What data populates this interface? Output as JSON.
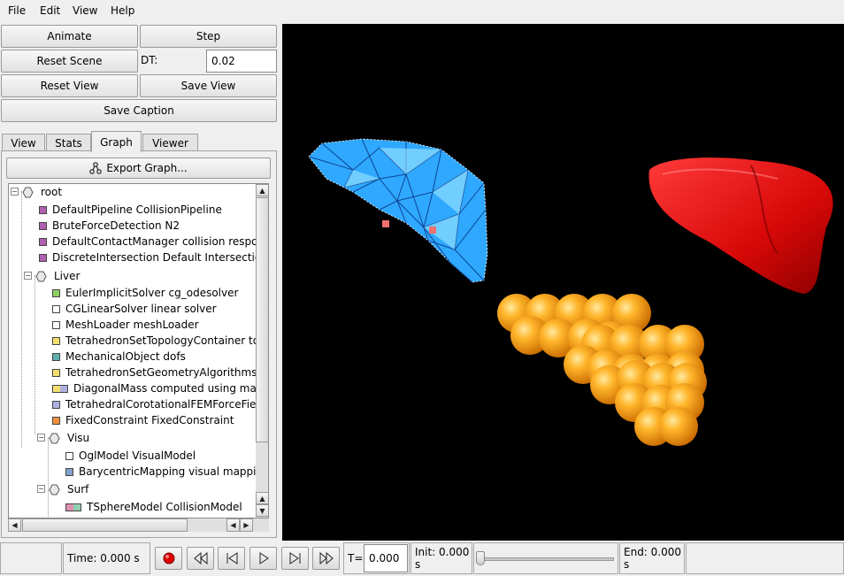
{
  "menu": {
    "file": "File",
    "edit": "Edit",
    "view": "View",
    "help": "Help"
  },
  "controls": {
    "animate": "Animate",
    "step": "Step",
    "reset_scene": "Reset Scene",
    "dt_label": "DT:",
    "dt_value": "0.02",
    "reset_view": "Reset View",
    "save_view": "Save View",
    "save_caption": "Save Caption"
  },
  "tabs": [
    "View",
    "Stats",
    "Graph",
    "Viewer"
  ],
  "active_tab": "Graph",
  "export_graph": "Export Graph...",
  "tree": [
    {
      "name": "root",
      "kind": "node"
    },
    {
      "name": "DefaultPipeline  CollisionPipeline",
      "color": "#b060b0"
    },
    {
      "name": "BruteForceDetection  N2",
      "color": "#b060b0"
    },
    {
      "name": "DefaultContactManager  collision respons",
      "color": "#b060b0"
    },
    {
      "name": "DiscreteIntersection  Default Intersection",
      "color": "#b060b0"
    },
    {
      "name": "Liver",
      "kind": "node"
    },
    {
      "name": "EulerImplicitSolver  cg_odesolver",
      "color": "#90d060"
    },
    {
      "name": "CGLinearSolver  linear solver",
      "color": "#ffffff"
    },
    {
      "name": "MeshLoader  meshLoader",
      "color": "#ffffff"
    },
    {
      "name": "TetrahedronSetTopologyContainer  top",
      "color": "#f0e070"
    },
    {
      "name": "MechanicalObject  dofs",
      "color": "#60b0b0"
    },
    {
      "name": "TetrahedronSetGeometryAlgorithms  Ge",
      "color": "#f0e070"
    },
    {
      "name": "DiagonalMass  computed using mass",
      "color": "#f0e070",
      "color2": "#b0b0e0"
    },
    {
      "name": "TetrahedralCorotationalFEMForceField",
      "color": "#b0b0e0"
    },
    {
      "name": "FixedConstraint  FixedConstraint",
      "color": "#f09040"
    },
    {
      "name": "Visu",
      "kind": "node"
    },
    {
      "name": "OglModel  VisualModel",
      "color": "#ffffff"
    },
    {
      "name": "BarycentricMapping  visual mapping",
      "color": "#80a0d0"
    },
    {
      "name": "Surf",
      "kind": "node"
    },
    {
      "name": "TSphereModel  CollisionModel",
      "color": "#e090b0",
      "color2": "#90d0b0"
    }
  ],
  "status": {
    "time": "Time: 0.000 s",
    "t_label": "T=",
    "t_value": "0.000",
    "init": "Init: 0.000 s",
    "end": "End: 0.000 s"
  },
  "colors": {
    "viewport_bg": "#000000",
    "liver_mesh": "#2fa8ff",
    "liver_surface": "#e81010",
    "spheres": "#ffa500",
    "record": "#e00000"
  }
}
